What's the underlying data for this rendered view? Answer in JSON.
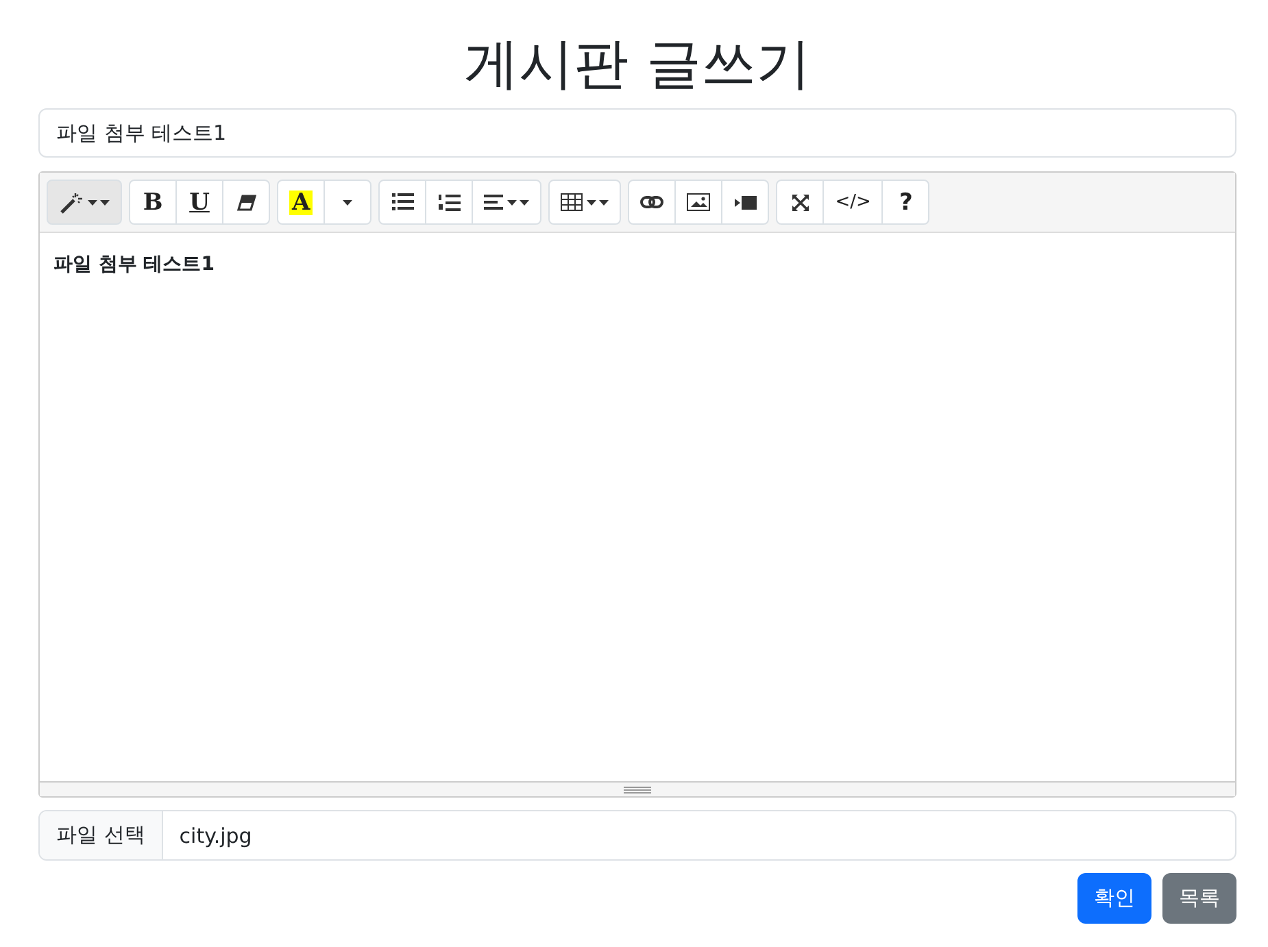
{
  "heading": "게시판 글쓰기",
  "title_field": {
    "value": "파일 첨부 테스트1"
  },
  "toolbar": [
    {
      "buttons": [
        {
          "kind": "magic",
          "pressed": true
        }
      ]
    },
    {
      "buttons": [
        {
          "kind": "bold",
          "label": "B",
          "pressed": false
        },
        {
          "kind": "underline",
          "label": "U",
          "pressed": false
        },
        {
          "kind": "eraser",
          "pressed": false
        }
      ]
    },
    {
      "buttons": [
        {
          "kind": "color",
          "label": "A",
          "pressed": false
        },
        {
          "kind": "caret",
          "pressed": false
        }
      ]
    },
    {
      "buttons": [
        {
          "kind": "ul",
          "pressed": false
        },
        {
          "kind": "ol",
          "pressed": false
        },
        {
          "kind": "align",
          "pressed": false
        }
      ]
    },
    {
      "buttons": [
        {
          "kind": "table",
          "pressed": false
        }
      ]
    },
    {
      "buttons": [
        {
          "kind": "link",
          "pressed": false
        },
        {
          "kind": "image",
          "pressed": false
        },
        {
          "kind": "video",
          "pressed": false
        }
      ]
    },
    {
      "buttons": [
        {
          "kind": "fullscreen",
          "pressed": false
        },
        {
          "kind": "code",
          "label": "</>",
          "pressed": false
        },
        {
          "kind": "help",
          "label": "?",
          "pressed": false
        }
      ]
    }
  ],
  "editor_content": "파일 첨부 테스트1",
  "file_field": {
    "button": "파일 선택",
    "value": "city.jpg"
  },
  "buttons": [
    {
      "label": "확인",
      "kind": "primary"
    },
    {
      "label": "목록",
      "kind": "secondary"
    }
  ]
}
